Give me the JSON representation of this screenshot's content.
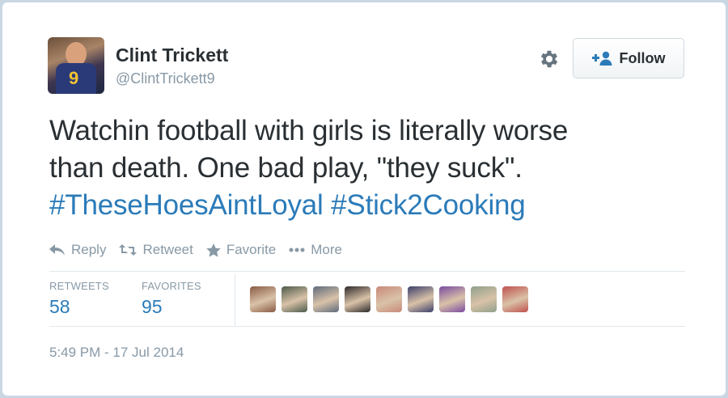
{
  "user": {
    "name": "Clint Trickett",
    "handle": "@ClintTrickett9",
    "avatar_number": "9"
  },
  "follow_button": {
    "label": "Follow"
  },
  "tweet": {
    "line1": "Watchin football with girls is literally worse",
    "line2": "than death. One bad play, \"they suck\".",
    "hashtag1": "#TheseHoesAintLoyal",
    "hashtag2": "#Stick2Cooking"
  },
  "actions": {
    "reply": "Reply",
    "retweet": "Retweet",
    "favorite": "Favorite",
    "more": "More"
  },
  "stats": {
    "retweets_label": "RETWEETS",
    "retweets_value": "58",
    "favorites_label": "FAVORITES",
    "favorites_value": "95"
  },
  "favoriters": [
    {
      "icon": "user-avatar-1",
      "color": "#8a5a44"
    },
    {
      "icon": "user-avatar-2",
      "color": "#4b5a4a"
    },
    {
      "icon": "user-avatar-3",
      "color": "#5e6b7d"
    },
    {
      "icon": "user-avatar-4",
      "color": "#2d2a2a"
    },
    {
      "icon": "user-avatar-5",
      "color": "#c98a7a"
    },
    {
      "icon": "user-avatar-6",
      "color": "#3b3f6b"
    },
    {
      "icon": "user-avatar-7",
      "color": "#7a4aa0"
    },
    {
      "icon": "user-avatar-8",
      "color": "#8fa08a"
    },
    {
      "icon": "user-avatar-9",
      "color": "#c0504d"
    }
  ],
  "timestamp": "5:49 PM - 17 Jul 2014",
  "colors": {
    "link": "#2b7bb9",
    "muted": "#8899a6",
    "text": "#292f33"
  }
}
